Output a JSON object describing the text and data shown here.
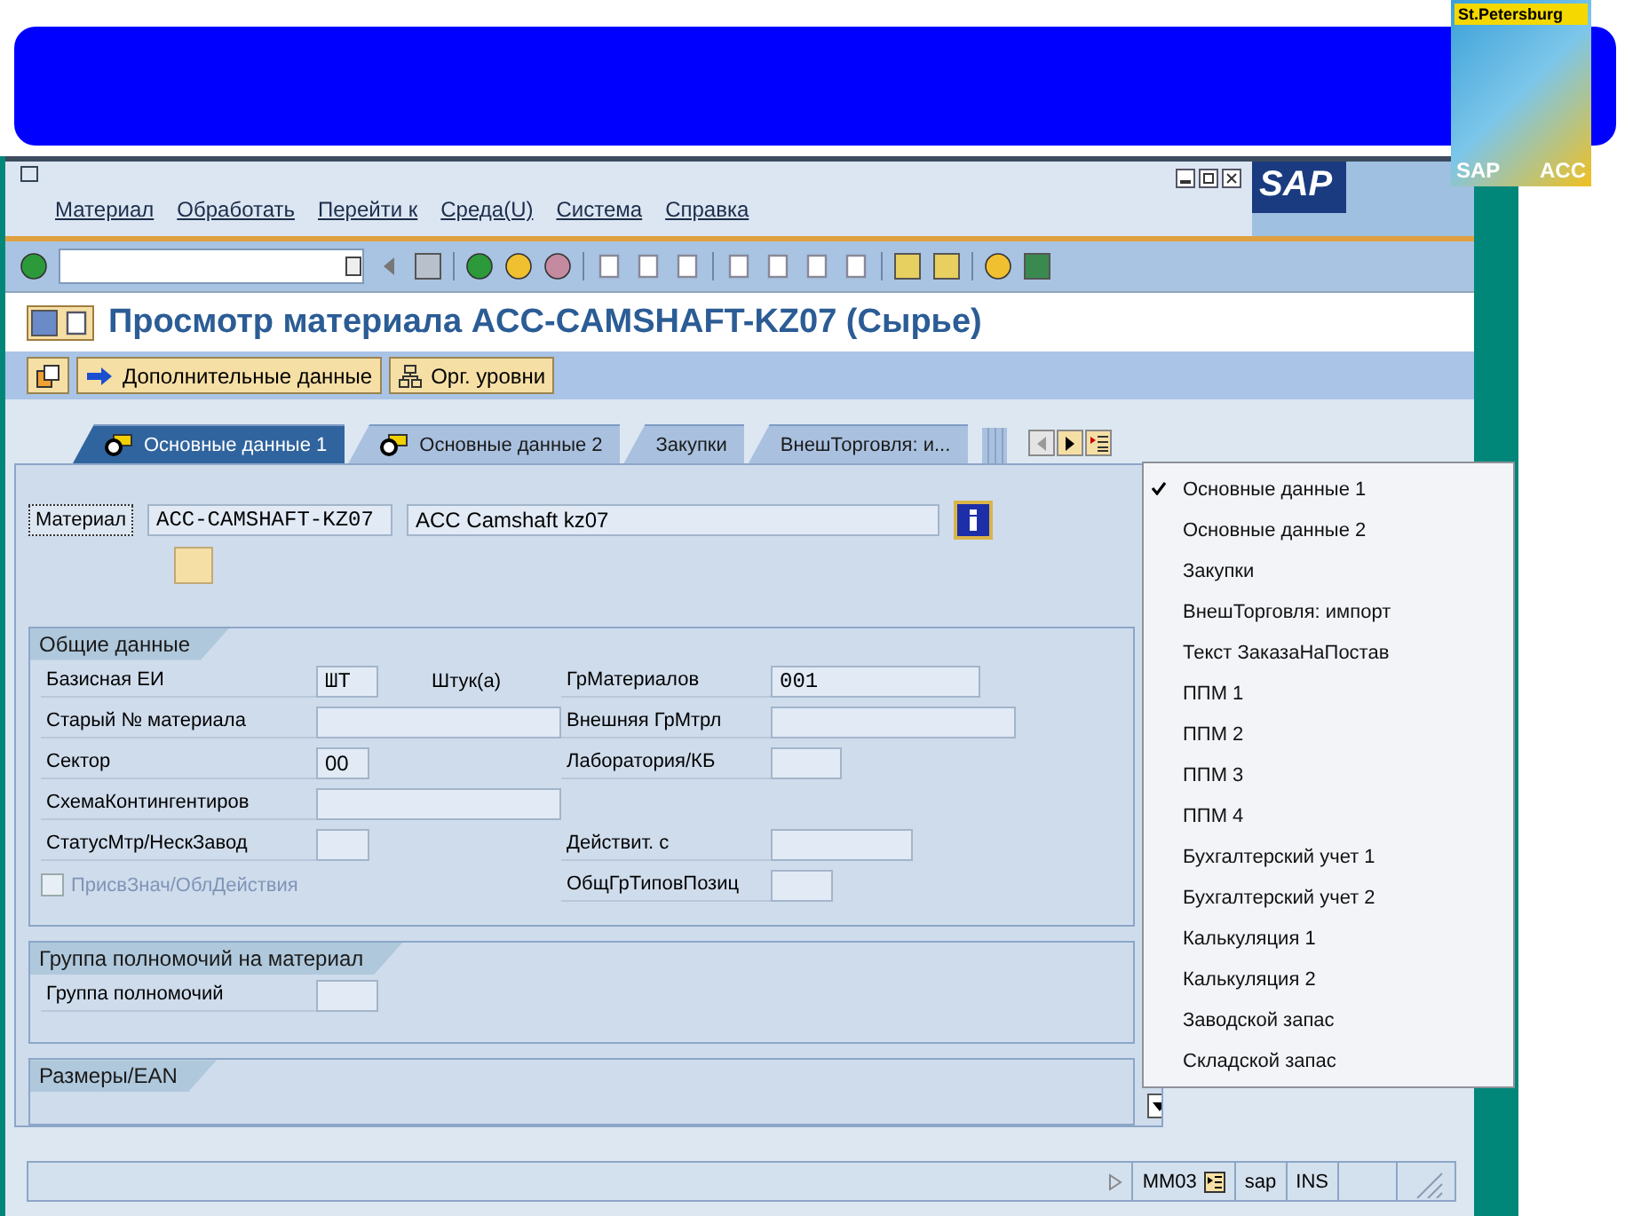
{
  "logo": {
    "city": "St.Petersburg",
    "brand": "SAP",
    "center": "ACC"
  },
  "window": {
    "menu": [
      {
        "label": "Материал"
      },
      {
        "label": "Обработать"
      },
      {
        "label": "Перейти к"
      },
      {
        "label": "Среда(U)"
      },
      {
        "label": "Система"
      },
      {
        "label": "Справка"
      }
    ],
    "brand": "SAP"
  },
  "title": "Просмотр материала ACC-CAMSHAFT-KZ07 (Сырье)",
  "app_toolbar": [
    {
      "label": "Дополнительные данные"
    },
    {
      "label": "Орг. уровни"
    }
  ],
  "tabs": [
    {
      "label": "Основные данные 1",
      "selected": true,
      "kind": "icon"
    },
    {
      "label": "Основные данные 2",
      "selected": false,
      "kind": "icon"
    },
    {
      "label": "Закупки",
      "selected": false,
      "kind": "plain"
    },
    {
      "label": "ВнешТорговля: и...",
      "selected": false,
      "kind": "stack"
    }
  ],
  "material": {
    "label": "Материал",
    "number": "ACC-CAMSHAFT-KZ07",
    "description": "ACC Camshaft kz07"
  },
  "general": {
    "title": "Общие данные",
    "rows": [
      {
        "left": {
          "label": "Базисная ЕИ",
          "value": "ШТ",
          "note": "Штук(а)"
        },
        "right": {
          "label": "ГрМатериалов",
          "value": "001"
        }
      },
      {
        "left": {
          "label": "Старый № материала"
        },
        "right": {
          "label": "Внешняя ГрМтрл"
        }
      },
      {
        "left": {
          "label": "Сектор",
          "value": "00"
        },
        "right": {
          "label": "Лаборатория/КБ"
        }
      },
      {
        "left": {
          "label": "СхемаКонтингентиров"
        }
      },
      {
        "left": {
          "label": "СтатусМтр/НескЗавод"
        },
        "right": {
          "label": "Действит. с"
        }
      },
      {
        "checkbox": {
          "label": "ПрисвЗнач/ОблДействия",
          "checked": false,
          "disabled": true
        },
        "right": {
          "label": "ОбщГрТиповПозиц"
        }
      }
    ]
  },
  "auth_group": {
    "title": "Группа полномочий на материал",
    "label": "Группа полномочий"
  },
  "dimensions": {
    "title": "Размеры/EAN"
  },
  "tab_menu": [
    {
      "label": "Основные данные 1",
      "selected": true
    },
    {
      "label": "Основные данные 2",
      "selected": false
    },
    {
      "label": "Закупки",
      "selected": false
    },
    {
      "label": "ВнешТорговля: импорт",
      "selected": false
    },
    {
      "label": "Текст ЗаказаНаПостав",
      "selected": false
    },
    {
      "label": "ППМ 1",
      "selected": false
    },
    {
      "label": "ППМ 2",
      "selected": false
    },
    {
      "label": "ППМ 3",
      "selected": false
    },
    {
      "label": "ППМ 4",
      "selected": false
    },
    {
      "label": "Бухгалтерский учет 1",
      "selected": false
    },
    {
      "label": "Бухгалтерский учет 2",
      "selected": false
    },
    {
      "label": "Калькуляция 1",
      "selected": false
    },
    {
      "label": "Калькуляция 2",
      "selected": false
    },
    {
      "label": "Заводской запас",
      "selected": false
    },
    {
      "label": "Складской запас",
      "selected": false
    }
  ],
  "status_bar": {
    "transaction": "MM03",
    "client": "sap",
    "mode": "INS"
  }
}
